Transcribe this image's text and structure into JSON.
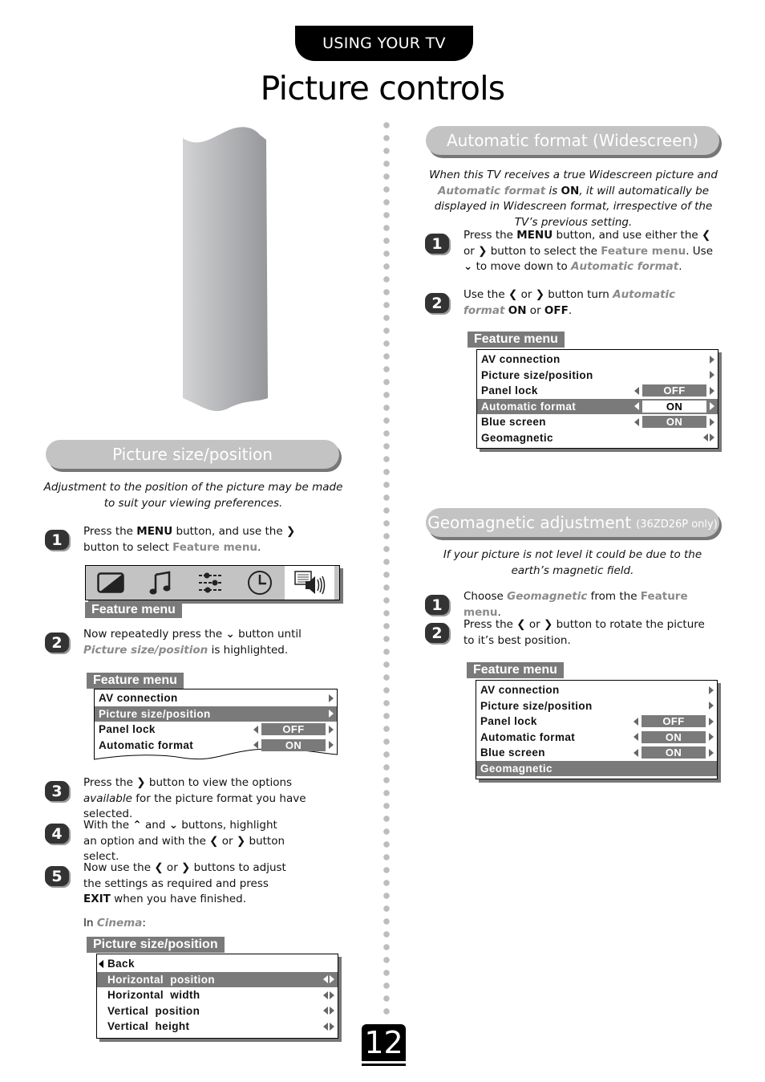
{
  "header": {
    "section_tab": "USING YOUR TV",
    "page_title": "Picture controls"
  },
  "page_number": "12",
  "left": {
    "section_title": "Picture size/position",
    "intro": "Adjustment to the position of the picture may be made to suit your viewing preferences.",
    "steps": [
      {
        "num": "1",
        "parts": [
          "Press the ",
          "MENU",
          " button, and use the ",
          "❯",
          " button to select ",
          "Feature menu",
          "."
        ]
      },
      {
        "num": "2",
        "parts": [
          "Now repeatedly press the ",
          "⌄",
          " button until ",
          "Picture size/position",
          " is highlighted."
        ]
      },
      {
        "num": "3",
        "parts": [
          "Press the ",
          "❯",
          " button to view the options ",
          "available",
          " for the picture format you have selected."
        ]
      },
      {
        "num": "4",
        "parts": [
          "With the ",
          "⌃",
          " and ",
          "⌄",
          " buttons, highlight an option and with the ",
          "❮",
          " or ",
          "❯",
          " button select."
        ]
      },
      {
        "num": "5",
        "parts": [
          "Now use the ",
          "❮",
          " or ",
          "❯",
          " buttons to adjust the settings as required and press ",
          "EXIT",
          " when you have finished."
        ]
      }
    ],
    "cinema_note": {
      "prefix": "In ",
      "mode": "Cinema",
      "suffix": ":"
    },
    "icon_bar": {
      "label": "Feature menu",
      "icons": [
        "picture-icon",
        "music-note-icon",
        "sliders-icon",
        "clock-icon",
        "feature-speaker-icon"
      ],
      "active_index": 4
    },
    "menu_partial": {
      "label": "Feature menu",
      "rows": [
        {
          "label": "AV connection",
          "value": null,
          "selected": false
        },
        {
          "label": "Picture size/position",
          "value": null,
          "selected": true
        },
        {
          "label": "Panel lock",
          "value": "OFF",
          "selected": false
        },
        {
          "label": "Automatic format",
          "value": "ON",
          "selected": false
        }
      ]
    },
    "submenu": {
      "label": "Picture size/position",
      "back": "Back",
      "rows": [
        {
          "label": "Horizontal  position",
          "selected": true
        },
        {
          "label": "Horizontal  width",
          "selected": false
        },
        {
          "label": "Vertical  position",
          "selected": false
        },
        {
          "label": "Vertical  height",
          "selected": false
        }
      ]
    }
  },
  "right": {
    "auto": {
      "section_title": "Automatic format (Widescreen)",
      "intro_parts": [
        "When this TV receives a true Widescreen picture and ",
        "Automatic format",
        " is ",
        "ON",
        ", it will automatically be displayed in Widescreen format, irrespective of the TV’s previous setting."
      ],
      "steps": [
        {
          "num": "1",
          "parts": [
            "Press the ",
            "MENU",
            " button, and use either the ",
            "❮",
            " or ",
            "❯",
            " button to select the ",
            "Feature menu",
            ". Use ",
            "⌄",
            " to move down to ",
            "Automatic format",
            "."
          ]
        },
        {
          "num": "2",
          "parts": [
            "Use the ",
            "❮",
            " or ",
            "❯",
            " button turn ",
            "Automatic format",
            " ",
            "ON",
            " or ",
            "OFF",
            "."
          ]
        }
      ],
      "menu": {
        "label": "Feature menu",
        "rows": [
          {
            "label": "AV connection",
            "value": null,
            "type": "arrow",
            "selected": false
          },
          {
            "label": "Picture size/position",
            "value": null,
            "type": "arrow",
            "selected": false
          },
          {
            "label": "Panel lock",
            "value": "OFF",
            "type": "value",
            "selected": false
          },
          {
            "label": "Automatic format",
            "value": "ON",
            "type": "value",
            "selected": true
          },
          {
            "label": "Blue screen",
            "value": "ON",
            "type": "value",
            "selected": false
          },
          {
            "label": "Geomagnetic",
            "value": null,
            "type": "both",
            "selected": false
          }
        ]
      }
    },
    "geo": {
      "section_title": "Geomagnetic adjustment",
      "section_note": "(36ZD26P only)",
      "intro": "If your picture is not level it could be due to the earth’s magnetic field.",
      "steps": [
        {
          "num": "1",
          "parts": [
            "Choose ",
            "Geomagnetic",
            " from the ",
            "Feature menu",
            "."
          ]
        },
        {
          "num": "2",
          "parts": [
            "Press the ",
            "❮",
            " or ",
            "❯",
            " button to rotate the picture to it’s best position."
          ]
        }
      ],
      "menu": {
        "label": "Feature menu",
        "rows": [
          {
            "label": "AV connection",
            "value": null,
            "type": "arrow",
            "selected": false
          },
          {
            "label": "Picture size/position",
            "value": null,
            "type": "arrow",
            "selected": false
          },
          {
            "label": "Panel lock",
            "value": "OFF",
            "type": "value",
            "selected": false
          },
          {
            "label": "Automatic format",
            "value": "ON",
            "type": "value",
            "selected": false
          },
          {
            "label": "Blue screen",
            "value": "ON",
            "type": "value",
            "selected": false
          },
          {
            "label": "Geomagnetic",
            "value": null,
            "type": "none",
            "selected": true
          }
        ]
      }
    }
  },
  "colors": {
    "highlight_text": "#8a8a8a",
    "menu_grey": "#7a7a7a",
    "pill_grey": "#c3c3c3"
  }
}
